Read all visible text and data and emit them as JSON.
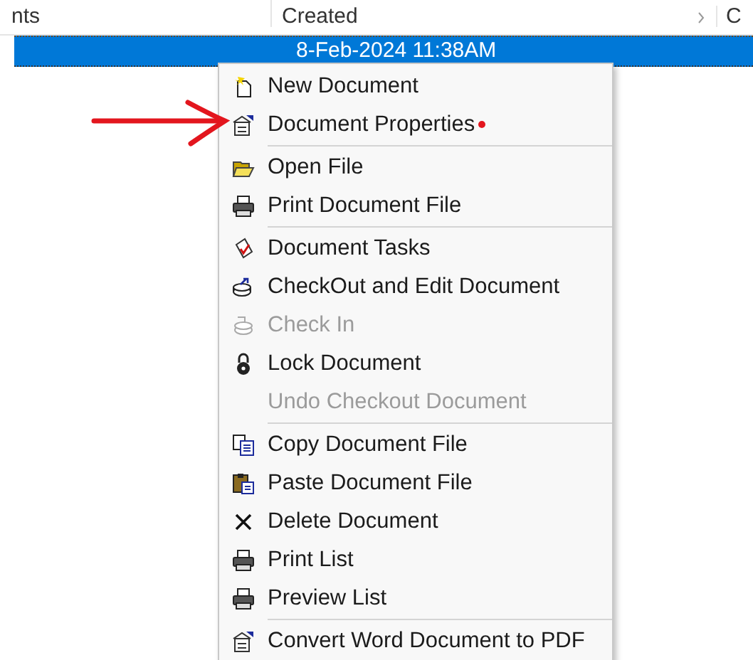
{
  "table": {
    "columns": [
      {
        "label": "nts"
      },
      {
        "label": "Created"
      },
      {
        "label": "C"
      }
    ],
    "rows": [
      {
        "cells": [
          "",
          "8-Feb-2024 11:38AM"
        ],
        "selected": true
      }
    ]
  },
  "context_menu": {
    "items": [
      {
        "kind": "item",
        "label": "New Document",
        "disabled": false,
        "flagged": false
      },
      {
        "kind": "item",
        "label": "Document Properties",
        "disabled": false,
        "flagged": true
      },
      {
        "kind": "separator"
      },
      {
        "kind": "item",
        "label": "Open File",
        "disabled": false,
        "flagged": false
      },
      {
        "kind": "item",
        "label": "Print Document File",
        "disabled": false,
        "flagged": false
      },
      {
        "kind": "separator"
      },
      {
        "kind": "item",
        "label": "Document Tasks",
        "disabled": false,
        "flagged": false
      },
      {
        "kind": "item",
        "label": "CheckOut and Edit Document",
        "disabled": false,
        "flagged": false
      },
      {
        "kind": "item",
        "label": "Check In",
        "disabled": true,
        "flagged": false
      },
      {
        "kind": "item",
        "label": "Lock Document",
        "disabled": false,
        "flagged": false
      },
      {
        "kind": "item",
        "label": "Undo Checkout Document",
        "disabled": true,
        "flagged": false
      },
      {
        "kind": "separator"
      },
      {
        "kind": "item",
        "label": "Copy Document File",
        "disabled": false,
        "flagged": false
      },
      {
        "kind": "item",
        "label": "Paste Document File",
        "disabled": false,
        "flagged": false
      },
      {
        "kind": "item",
        "label": "Delete Document",
        "disabled": false,
        "flagged": false
      },
      {
        "kind": "item",
        "label": "Print List",
        "disabled": false,
        "flagged": false
      },
      {
        "kind": "item",
        "label": "Preview List",
        "disabled": false,
        "flagged": false
      },
      {
        "kind": "separator"
      },
      {
        "kind": "item",
        "label": "Convert Word Document to PDF",
        "disabled": false,
        "flagged": false
      }
    ]
  }
}
